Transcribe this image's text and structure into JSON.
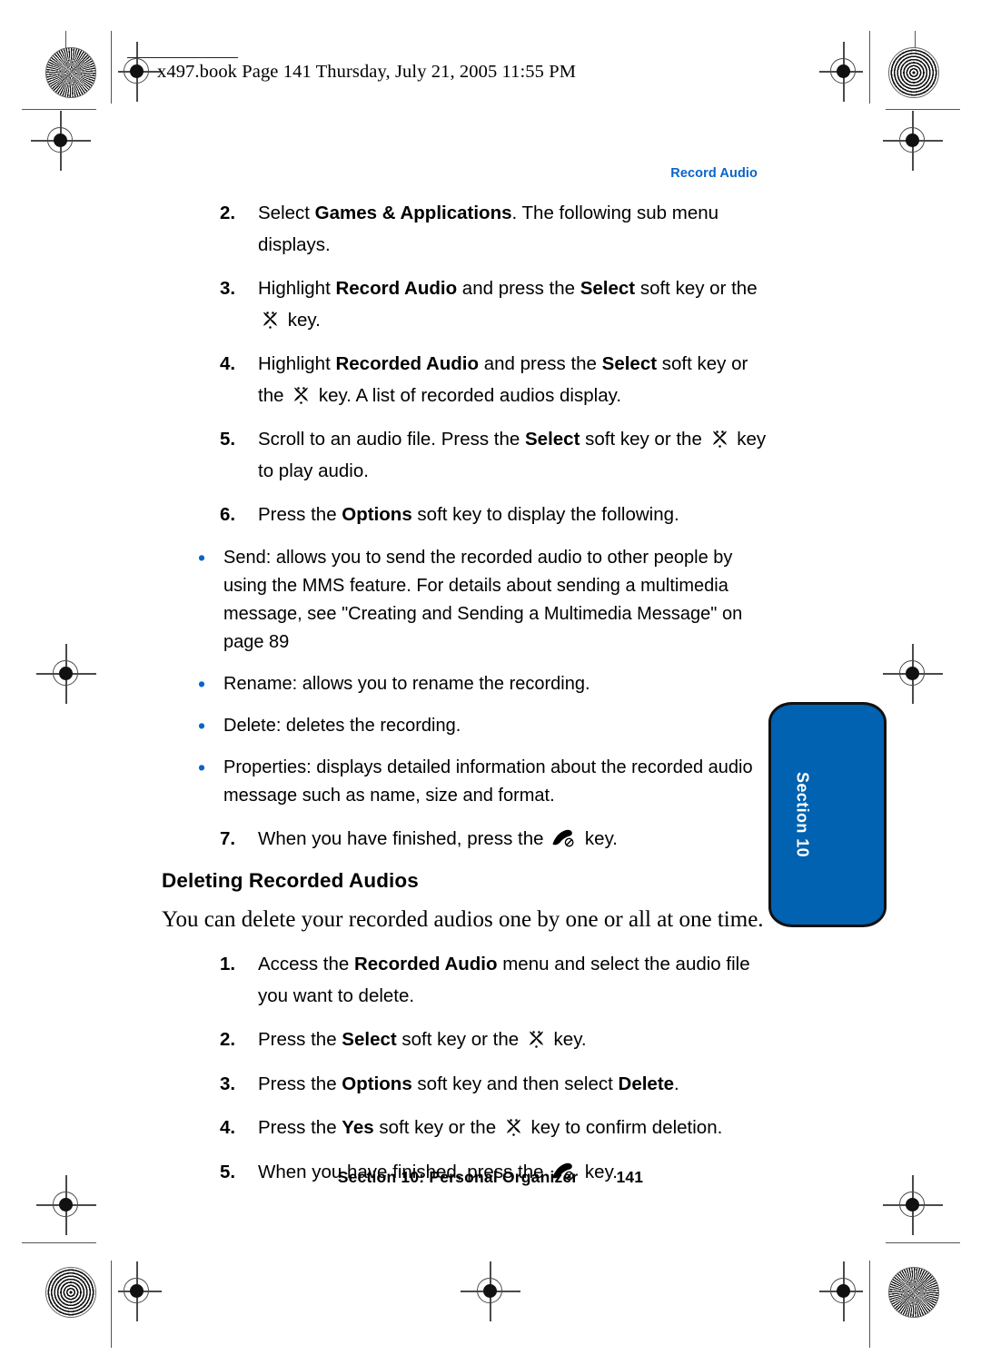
{
  "page": {
    "header_line": "x497.book  Page 141  Thursday, July 21, 2005  11:55 PM",
    "running_head": "Record Audio",
    "footer_section": "Section 10: Personal Organizer",
    "footer_page": "141",
    "accent_blue": "#0062b0",
    "running_head_blue": "#0a64c8"
  },
  "thumb_tab": {
    "label": "Section 10",
    "background": "#0062b0",
    "text_color": "#ffffff"
  },
  "icons": {
    "ok_key": "navigation-ok-key-icon",
    "end_key": "end-call-key-icon",
    "bullet": "bullet-dot-icon"
  },
  "steps_top": [
    {
      "num": "2.",
      "parts": [
        {
          "t": "Select ",
          "b": false
        },
        {
          "t": "Games & Applications",
          "b": true
        },
        {
          "t": ". The following sub menu displays.",
          "b": false
        }
      ]
    },
    {
      "num": "3.",
      "parts": [
        {
          "t": "Highlight ",
          "b": false
        },
        {
          "t": "Record Audio",
          "b": true
        },
        {
          "t": " and press the ",
          "b": false
        },
        {
          "t": "Select",
          "b": true
        },
        {
          "t": " soft key or the ",
          "b": false
        },
        {
          "icon": "ok_key"
        },
        {
          "t": " key.",
          "b": false
        }
      ]
    },
    {
      "num": "4.",
      "parts": [
        {
          "t": "Highlight ",
          "b": false
        },
        {
          "t": "Recorded Audio",
          "b": true
        },
        {
          "t": " and press the ",
          "b": false
        },
        {
          "t": "Select",
          "b": true
        },
        {
          "t": " soft key or the ",
          "b": false
        },
        {
          "icon": "ok_key"
        },
        {
          "t": " key. A list of recorded audios display.",
          "b": false
        }
      ]
    },
    {
      "num": "5.",
      "parts": [
        {
          "t": "Scroll to an audio file. Press the ",
          "b": false
        },
        {
          "t": "Select",
          "b": true
        },
        {
          "t": " soft key or the ",
          "b": false
        },
        {
          "icon": "ok_key"
        },
        {
          "t": " key to play audio.",
          "b": false
        }
      ]
    },
    {
      "num": "6.",
      "parts": [
        {
          "t": "Press the ",
          "b": false
        },
        {
          "t": "Options",
          "b": true
        },
        {
          "t": " soft key to display the following.",
          "b": false
        }
      ]
    }
  ],
  "bullets": [
    {
      "parts": [
        {
          "t": "Send: allows you to send the recorded audio to other people by using the MMS feature. For details about sending a multimedia message, see \"Creating and Sending a Multimedia Message\" on page 89",
          "b": false
        }
      ]
    },
    {
      "parts": [
        {
          "t": "Rename: allows you to rename the recording.",
          "b": false
        }
      ]
    },
    {
      "parts": [
        {
          "t": "Delete: deletes the recording.",
          "b": false
        }
      ]
    },
    {
      "parts": [
        {
          "t": "Properties: displays detailed information about the recorded audio message such as name, size and format.",
          "b": false
        }
      ]
    }
  ],
  "step_seven": {
    "num": "7.",
    "parts": [
      {
        "t": "When you have finished, press the ",
        "b": false
      },
      {
        "icon": "end_key"
      },
      {
        "t": " key.",
        "b": false
      }
    ]
  },
  "section": {
    "heading": "Deleting Recorded Audios",
    "lede": "You can delete your recorded audios one by one or all at one time."
  },
  "steps_bottom": [
    {
      "num": "1.",
      "parts": [
        {
          "t": "Access the ",
          "b": false
        },
        {
          "t": "Recorded Audio",
          "b": true
        },
        {
          "t": " menu and select the audio file you want to delete.",
          "b": false
        }
      ]
    },
    {
      "num": "2.",
      "parts": [
        {
          "t": "Press the ",
          "b": false
        },
        {
          "t": "Select",
          "b": true
        },
        {
          "t": " soft key or the ",
          "b": false
        },
        {
          "icon": "ok_key"
        },
        {
          "t": " key.",
          "b": false
        }
      ]
    },
    {
      "num": "3.",
      "parts": [
        {
          "t": "Press the ",
          "b": false
        },
        {
          "t": "Options",
          "b": true
        },
        {
          "t": " soft key and then select ",
          "b": false
        },
        {
          "t": "Delete",
          "b": true
        },
        {
          "t": ".",
          "b": false
        }
      ]
    },
    {
      "num": "4.",
      "parts": [
        {
          "t": "Press the ",
          "b": false
        },
        {
          "t": "Yes",
          "b": true
        },
        {
          "t": " soft key or the ",
          "b": false
        },
        {
          "icon": "ok_key"
        },
        {
          "t": " key to confirm deletion.",
          "b": false
        }
      ]
    },
    {
      "num": "5.",
      "parts": [
        {
          "t": "When you have finished, press the ",
          "b": false
        },
        {
          "icon": "end_key"
        },
        {
          "t": " key.",
          "b": false
        }
      ]
    }
  ]
}
